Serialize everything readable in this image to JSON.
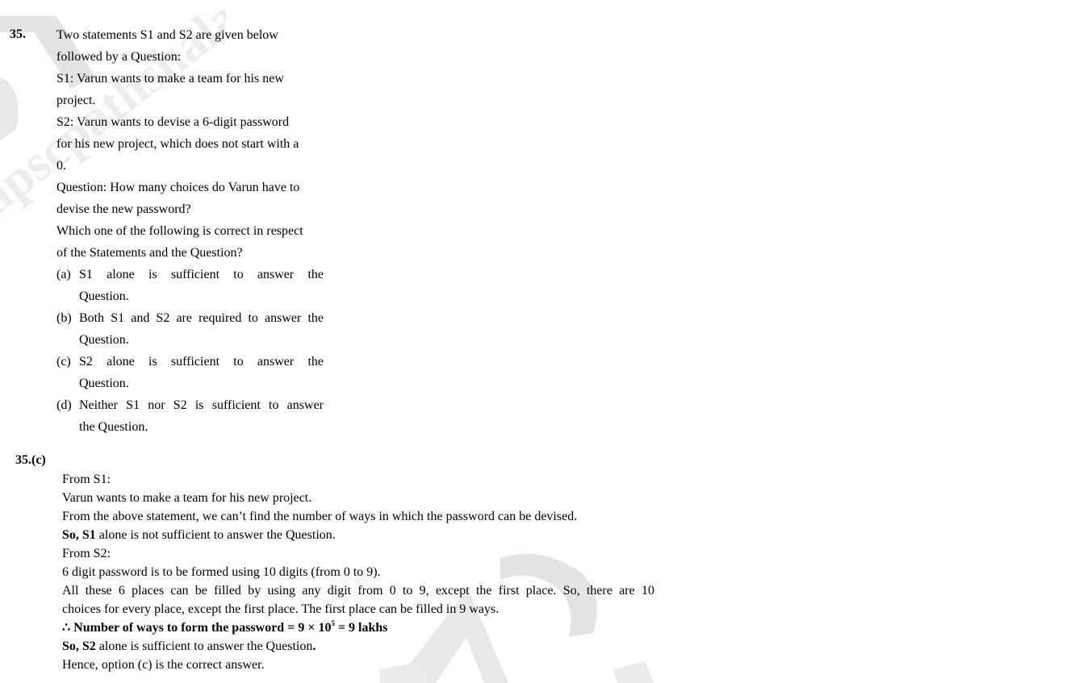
{
  "question": {
    "number": "35.",
    "stem_1": "Two statements S1 and S2 are given below",
    "stem_2": "followed by a Question:",
    "s1_1": "S1: Varun wants to make a team for his new",
    "s1_2": "project.",
    "s2_1": "S2: Varun wants to devise a 6-digit password",
    "s2_2": "for his new project, which does not start with a",
    "s2_3": "0.",
    "q_1": "Question: How many choices do Varun have to",
    "q_2": "devise the new password?",
    "w_1": "Which one of the following is correct in respect",
    "w_2": "of the Statements and the Question?",
    "options": [
      {
        "label": "(a)",
        "line1": "S1 alone is sufficient to answer the",
        "line2": "Question."
      },
      {
        "label": "(b)",
        "line1": "Both S1 and S2 are required to answer the",
        "line2": "Question."
      },
      {
        "label": "(c)",
        "line1": "S2 alone is sufficient to answer the",
        "line2": "Question."
      },
      {
        "label": "(d)",
        "line1": "Neither S1 nor S2 is sufficient to answer",
        "line2": "the Question."
      }
    ]
  },
  "answer": {
    "number": "35.(c)",
    "l1": "From S1:",
    "l2": "Varun wants to make a team for his new project.",
    "l3": "From the above statement, we can’t find the number of ways in which the password can be devised.",
    "l4_bold": "So, S1",
    "l4_rest": " alone is not sufficient to answer the Question.",
    "l5": "From S2:",
    "l6": "6 digit password is to be formed using 10 digits (from 0 to 9).",
    "l7": "All these 6 places can be filled by using any digit from 0 to 9, except the first place. So, there are 10",
    "l8": "choices for every place, except the first place. The first place can be filled in 9 ways.",
    "l9_a": "∴ Number of ways to form the password = 9 × 10",
    "l9_sup": "5",
    "l9_b": " = 9 lakhs",
    "l10_bold": "So, S2",
    "l10_rest": " alone is sufficient to answer the Question",
    "l10_dot": ".",
    "l11": "Hence, option (c) is the correct answer."
  },
  "colors": {
    "watermark": "#e6e6e6",
    "text": "#000000"
  }
}
